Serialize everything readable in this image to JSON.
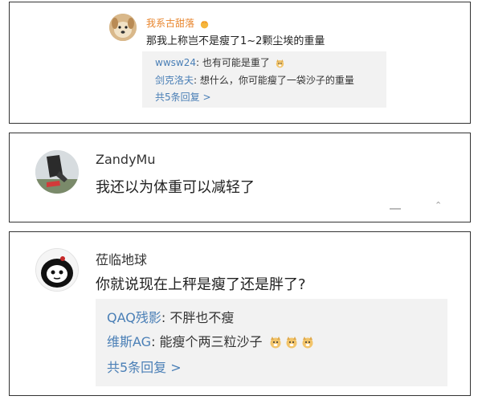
{
  "cards": [
    {
      "user": "我系古甜落",
      "comment": "那我上称岂不是瘦了1~2颗尘埃的重量",
      "replies": [
        {
          "name": "wwsw24",
          "text": ": 也有可能是重了"
        },
        {
          "name": "剑克洛夫",
          "text": ": 想什么，你可能瘦了一袋沙子的重量"
        }
      ],
      "more": "共5条回复 >"
    },
    {
      "user": "ZandyMu",
      "comment": "我还以为体重可以减轻了"
    },
    {
      "user": "莅临地球",
      "comment": "你就说现在上秤是瘦了还是胖了?",
      "replies": [
        {
          "name": "QAQ残影",
          "text": ": 不胖也不瘦"
        },
        {
          "name": "维斯AG",
          "text": ": 能瘦个两三粒沙子"
        }
      ],
      "more": "共5条回复 >"
    }
  ],
  "colors": {
    "link": "#4a7fb6",
    "username_highlight": "#e8852d",
    "reply_bg": "#f2f2f2"
  }
}
